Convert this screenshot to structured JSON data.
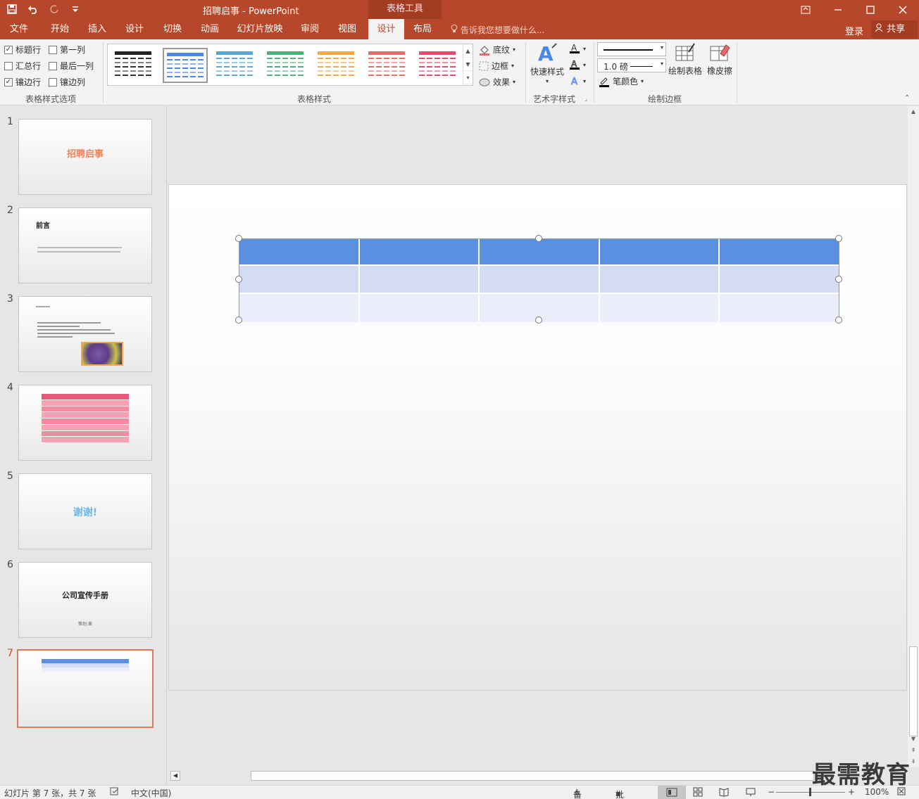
{
  "titlebar": {
    "doc_title": "招聘启事 - PowerPoint",
    "tools_tab": "表格工具",
    "qat_icons": [
      "save-icon",
      "undo-icon",
      "redo-icon",
      "customize-icon"
    ],
    "controls": [
      "ribbon-display-icon",
      "minimize-icon",
      "maximize-icon",
      "close-icon"
    ]
  },
  "tabs": {
    "items": [
      "文件",
      "开始",
      "插入",
      "设计",
      "切换",
      "动画",
      "幻灯片放映",
      "审阅",
      "视图",
      "设计",
      "布局"
    ],
    "tell_me": "告诉我您想要做什么...",
    "login": "登录",
    "share": "共享"
  },
  "ribbon": {
    "options": {
      "header_row": "标题行",
      "first_col": "第一列",
      "total_row": "汇总行",
      "last_col": "最后一列",
      "banded_rows": "镶边行",
      "banded_cols": "镶边列",
      "label": "表格样式选项"
    },
    "styles": {
      "label": "表格样式",
      "shading": "底纹",
      "border": "边框",
      "effects": "效果",
      "thumb_colors": [
        "#222222",
        "#4a86e8",
        "#5aa7d6",
        "#4bb17a",
        "#f4a742",
        "#e66b6b",
        "#e64b6b"
      ]
    },
    "wordart": {
      "quick_styles": "快速样式",
      "label": "艺术字样式"
    },
    "borders": {
      "weight": "1.0 磅",
      "pen_color": "笔颜色",
      "draw_table": "绘制表格",
      "eraser": "橡皮擦",
      "label": "绘制边框"
    }
  },
  "thumbnails": {
    "numbers": [
      "1",
      "2",
      "3",
      "4",
      "5",
      "6",
      "7"
    ],
    "s1_title": "招聘启事",
    "s2_title": "前言",
    "s5_title": "谢谢!",
    "s6_title": "公司宣传手册",
    "s6_sub": "策划:黄"
  },
  "status": {
    "slide_info": "幻灯片 第 7 张，共 7 张",
    "language": "中文(中国)",
    "notes": "备注",
    "comments": "批注",
    "zoom": "100%"
  },
  "watermark": "最需教育"
}
